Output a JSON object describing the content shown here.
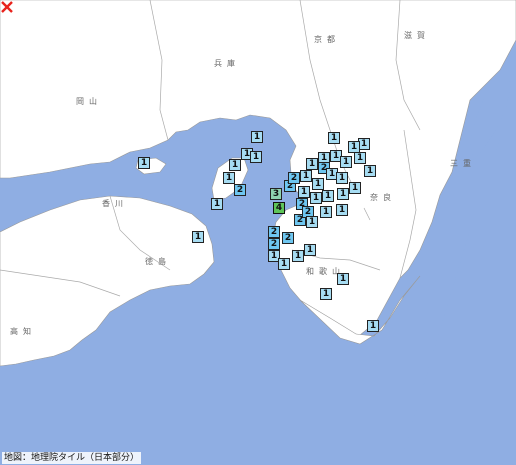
{
  "map": {
    "colors": {
      "sea": "#8faee3",
      "land": "#ffffff",
      "border": "#bbbbbb",
      "epicenter": "#e8231c"
    },
    "epicenter_icon": "red-x-cross",
    "pref_labels": [
      {
        "text": "兵庫"
      },
      {
        "text": "京都"
      },
      {
        "text": "滋賀"
      },
      {
        "text": "岡山"
      },
      {
        "text": "香川"
      },
      {
        "text": "徳島"
      },
      {
        "text": "奈良"
      },
      {
        "text": "三重"
      },
      {
        "text": "和歌山"
      },
      {
        "text": "高知"
      }
    ],
    "intensity_markers": [
      "1",
      "1",
      "1",
      "1",
      "1",
      "1",
      "1",
      "1",
      "1",
      "1",
      "1",
      "1",
      "1",
      "1",
      "1",
      "1",
      "1",
      "3",
      "2",
      "2",
      "2",
      "2",
      "2",
      "2",
      "1",
      "1",
      "1",
      "1",
      "1",
      "1",
      "1",
      "1",
      "1",
      "4",
      "2",
      "2",
      "2",
      "2",
      "1",
      "1",
      "1",
      "1",
      "1",
      "1",
      "1",
      "1",
      "1",
      "1"
    ],
    "credit": "地図：地理院タイル（日本部分）"
  }
}
